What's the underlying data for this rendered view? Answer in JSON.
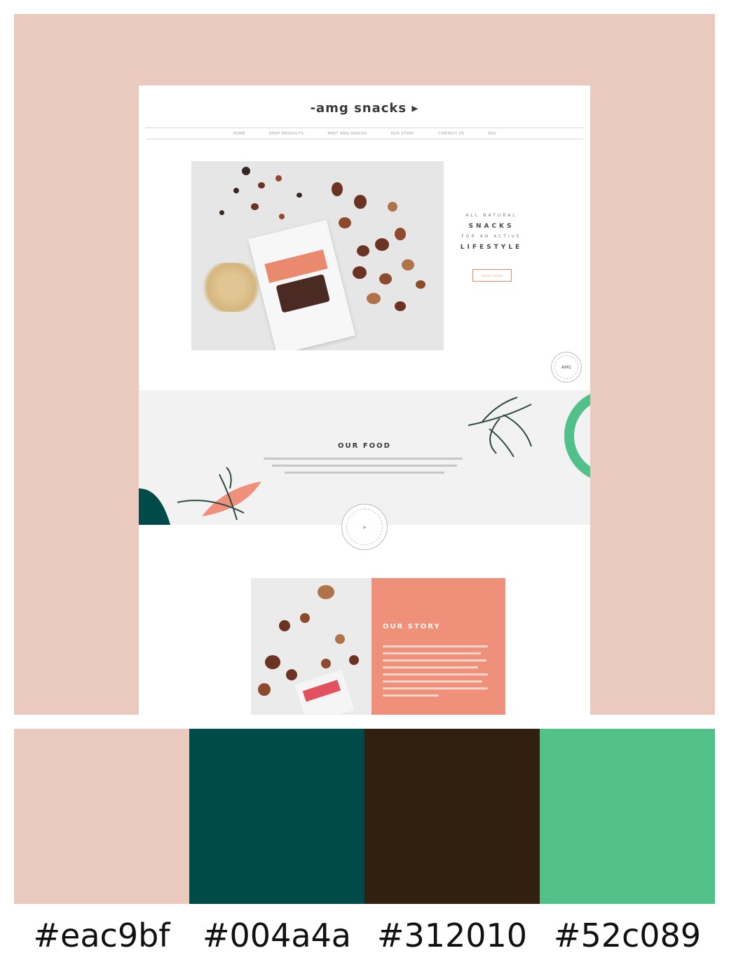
{
  "site": {
    "logo": "-amg snacks ▸",
    "nav": [
      "HOME",
      "SHOP PRODUCTS",
      "MEET AMG SNACKS",
      "OUR STORY",
      "CONTACT US",
      "FAQ"
    ],
    "hero": {
      "tagline_1": "ALL NATURAL",
      "tagline_2": "SNACKS",
      "tagline_3": "FOR AN ACTIVE",
      "tagline_4": "LIFESTYLE",
      "button_label": "SHOP NOW"
    },
    "badge_top": "AMG",
    "badge_bottom": "»",
    "food": {
      "title": "OUR FOOD"
    },
    "story": {
      "title": "OUR STORY"
    }
  },
  "palette": [
    {
      "hex": "#eac9bf",
      "label": "#eac9bf"
    },
    {
      "hex": "#004a4a",
      "label": "#004a4a"
    },
    {
      "hex": "#312010",
      "label": "#312010"
    },
    {
      "hex": "#52c089",
      "label": "#52c089"
    }
  ],
  "colors": {
    "frame_bg": "#eac9bf",
    "accent_coral": "#ef917a",
    "deep_teal": "#004a4a",
    "green": "#52c089"
  }
}
